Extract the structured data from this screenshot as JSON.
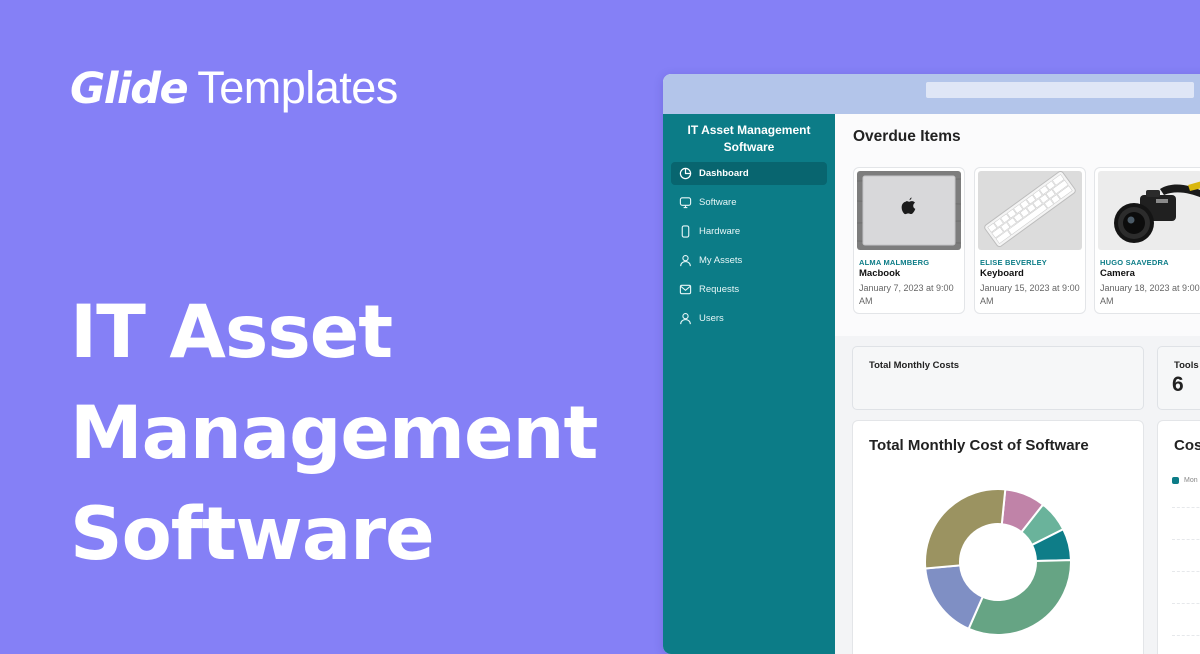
{
  "brand": {
    "logo": "Glide",
    "subtitle": "Templates"
  },
  "hero": {
    "lines": [
      "IT Asset",
      "Management",
      "Software"
    ]
  },
  "app": {
    "title": "IT Asset Management Software",
    "nav": [
      {
        "label": "Dashboard",
        "icon": "pie-chart-icon",
        "active": true
      },
      {
        "label": "Software",
        "icon": "monitor-icon"
      },
      {
        "label": "Hardware",
        "icon": "phone-icon"
      },
      {
        "label": "My Assets",
        "icon": "user-icon"
      },
      {
        "label": "Requests",
        "icon": "mail-icon"
      },
      {
        "label": "Users",
        "icon": "user-icon"
      }
    ]
  },
  "overdue": {
    "title": "Overdue Items",
    "items": [
      {
        "owner": "ALMA MALMBERG",
        "name": "Macbook",
        "date": "January 7, 2023 at 9:00 AM",
        "image": "laptop-image"
      },
      {
        "owner": "ELISE BEVERLEY",
        "name": "Keyboard",
        "date": "January 15, 2023 at 9:00 AM",
        "image": "keyboard-image"
      },
      {
        "owner": "HUGO SAAVEDRA",
        "name": "Camera",
        "date": "January 18, 2023 at 9:00 AM",
        "image": "camera-image"
      }
    ]
  },
  "stats": [
    {
      "label": "Total Monthly Costs",
      "value": ""
    },
    {
      "label": "Tools",
      "value": "6"
    }
  ],
  "charts": {
    "software_cost_title": "Total Monthly Cost of Software",
    "second_title_partial": "Cos",
    "legend_partial": "Mon"
  },
  "colors": {
    "page_background": "#8580F6",
    "sidebar": "#0c7c87",
    "accent": "#0c7c87"
  },
  "chart_data": {
    "type": "pie",
    "title": "Total Monthly Cost of Software",
    "donut": true,
    "slices": [
      {
        "value": 9,
        "color": "#c083a8"
      },
      {
        "value": 7,
        "color": "#6ab39b"
      },
      {
        "value": 7,
        "color": "#0e7d88"
      },
      {
        "value": 32,
        "color": "#66a484"
      },
      {
        "value": 17,
        "color": "#7f8fc4"
      },
      {
        "value": 28,
        "color": "#9b9361"
      }
    ]
  }
}
